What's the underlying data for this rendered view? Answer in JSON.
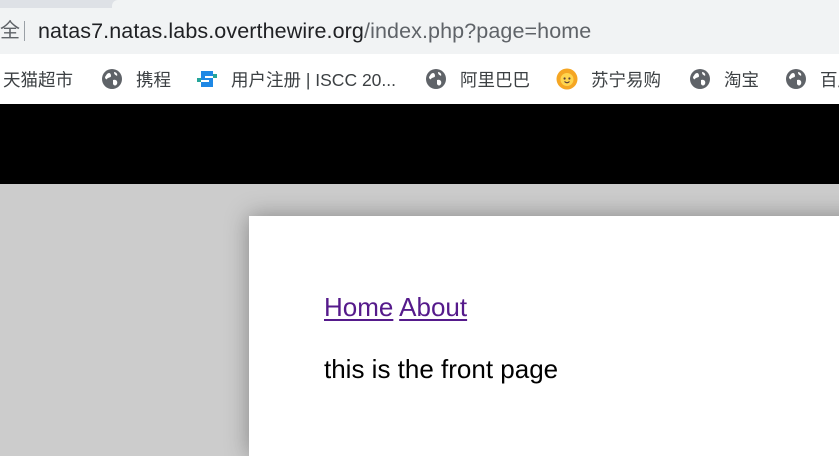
{
  "browser": {
    "address_bar": {
      "security_glyph": "全",
      "url_host": "natas7.natas.labs.overthewire.org",
      "url_path": "/index.php?page=home"
    },
    "bookmarks": [
      {
        "label": "天猫超市",
        "icon": "none"
      },
      {
        "label": "携程",
        "icon": "globe-icon"
      },
      {
        "label": "用户注册 | ISCC 20...",
        "icon": "iscc-logo-icon"
      },
      {
        "label": "阿里巴巴",
        "icon": "globe-icon"
      },
      {
        "label": "苏宁易购",
        "icon": "suning-lion-icon"
      },
      {
        "label": "淘宝",
        "icon": "globe-icon"
      },
      {
        "label": "百度",
        "icon": "globe-icon"
      }
    ]
  },
  "page": {
    "nav": {
      "home_label": "Home",
      "about_label": "About"
    },
    "body_text": "this is the front page"
  },
  "colors": {
    "page_background": "#cccccc",
    "header_band": "#000000",
    "link_visited": "#551a8b",
    "card_background": "#ffffff"
  }
}
